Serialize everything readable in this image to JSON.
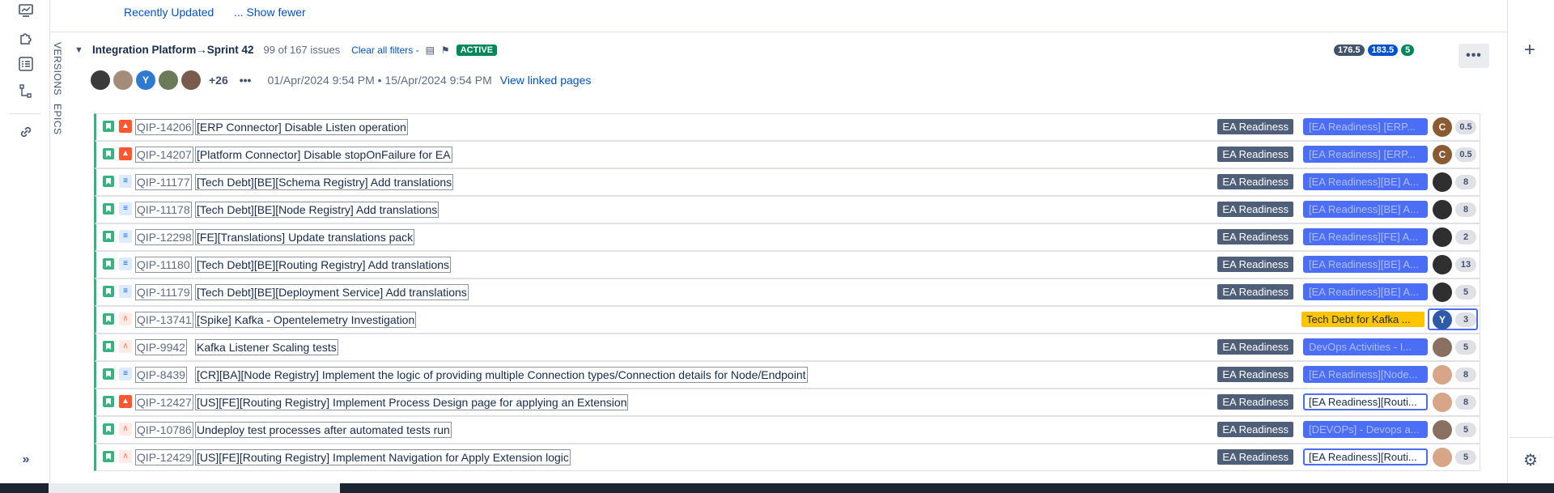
{
  "top_links": {
    "recent": "Recently Updated",
    "show_fewer": "... Show fewer"
  },
  "vertical_tabs": {
    "versions": "VERSIONS",
    "epics": "EPICS"
  },
  "sprint": {
    "name": "Integration Platform→Sprint 42",
    "issue_count": "99 of 167 issues",
    "clear_filters": "Clear all filters -",
    "status": "ACTIVE",
    "points": [
      "176.5",
      "183.5",
      "5"
    ],
    "extra_people": "+26",
    "dates": "01/Apr/2024 9:54 PM •  15/Apr/2024 9:54 PM",
    "view_linked": "View linked pages"
  },
  "avatars": [
    {
      "letter": "",
      "color": "#3b3b3b"
    },
    {
      "letter": "",
      "color": "#a58b7a"
    },
    {
      "letter": "Y",
      "color": "#2e7ad1"
    },
    {
      "letter": "",
      "color": "#6b7b5a"
    },
    {
      "letter": "",
      "color": "#7a5a4a"
    }
  ],
  "issues": [
    {
      "key": "QIP-14206",
      "summary": "[ERP Connector] Disable Listen operation",
      "epic": "EA Readiness",
      "version": "[EA Readiness] [ERP...",
      "prio": "high",
      "assignee": "C",
      "assignee_color": "#8a5a32",
      "est": "0.5",
      "version_style": "filled"
    },
    {
      "key": "QIP-14207",
      "summary": "[Platform Connector] Disable stopOnFailure for EA",
      "epic": "EA Readiness",
      "version": "[EA Readiness] [ERP...",
      "prio": "high",
      "assignee": "C",
      "assignee_color": "#8a5a32",
      "est": "0.5",
      "version_style": "filled"
    },
    {
      "key": "QIP-11177",
      "summary": "[Tech Debt][BE][Schema Registry] Add translations",
      "epic": "EA Readiness",
      "version": "[EA Readiness][BE] A...",
      "prio": "low",
      "assignee": "",
      "assignee_color": "#2f2f2f",
      "est": "8",
      "version_style": "filled"
    },
    {
      "key": "QIP-11178",
      "summary": "[Tech Debt][BE][Node Registry] Add translations",
      "epic": "EA Readiness",
      "version": "[EA Readiness][BE] A...",
      "prio": "low",
      "assignee": "",
      "assignee_color": "#2f2f2f",
      "est": "8",
      "version_style": "filled"
    },
    {
      "key": "QIP-12298",
      "summary": "[FE][Translations] Update translations pack",
      "epic": "EA Readiness",
      "version": "[EA Readiness][FE] A...",
      "prio": "low",
      "assignee": "",
      "assignee_color": "#2f2f2f",
      "est": "2",
      "version_style": "filled"
    },
    {
      "key": "QIP-11180",
      "summary": "[Tech Debt][BE][Routing Registry] Add translations",
      "epic": "EA Readiness",
      "version": "[EA Readiness][BE] A...",
      "prio": "low",
      "assignee": "",
      "assignee_color": "#2f2f2f",
      "est": "13",
      "version_style": "filled"
    },
    {
      "key": "QIP-11179",
      "summary": "[Tech Debt][BE][Deployment Service] Add translations",
      "epic": "EA Readiness",
      "version": "[EA Readiness][BE] A...",
      "prio": "low",
      "assignee": "",
      "assignee_color": "#2f2f2f",
      "est": "5",
      "version_style": "filled"
    },
    {
      "key": "QIP-13741",
      "summary": "[Spike] Kafka - Opentelemetry Investigation",
      "epic": "",
      "version": "Tech Debt for Kafka ...",
      "prio": "med",
      "assignee": "Y",
      "assignee_color": "#2e5aa8",
      "est": "3",
      "version_style": "yellow"
    },
    {
      "key": "QIP-9942",
      "summary": "Kafka Listener Scaling tests",
      "epic": "EA Readiness",
      "version": "DevOps Activities - I...",
      "prio": "med",
      "assignee": "",
      "assignee_color": "#8a7060",
      "est": "5",
      "version_style": "filled"
    },
    {
      "key": "QIP-8439",
      "summary": "[CR][BA][Node Registry] Implement the logic of providing multiple Connection types/Connection details for Node/Endpoint",
      "epic": "EA Readiness",
      "version": "[EA Readiness][Node...",
      "prio": "low",
      "assignee": "",
      "assignee_color": "#d9a588",
      "est": "8",
      "version_style": "filled"
    },
    {
      "key": "QIP-12427",
      "summary": "[US][FE][Routing Registry] Implement Process Design page for applying an Extension",
      "epic": "EA Readiness",
      "version": "[EA Readiness][Routi...",
      "prio": "high",
      "assignee": "",
      "assignee_color": "#d9a588",
      "est": "8",
      "version_style": "plain"
    },
    {
      "key": "QIP-10786",
      "summary": "Undeploy test processes after automated tests run",
      "epic": "EA Readiness",
      "version": "[DEVOPs] - Devops a...",
      "prio": "med",
      "assignee": "",
      "assignee_color": "#8a7060",
      "est": "5",
      "version_style": "filled"
    },
    {
      "key": "QIP-12429",
      "summary": "[US][FE][Routing Registry] Implement Navigation for Apply Extension logic",
      "epic": "EA Readiness",
      "version": "[EA Readiness][Routi...",
      "prio": "med",
      "assignee": "",
      "assignee_color": "#d9a588",
      "est": "5",
      "version_style": "plain"
    }
  ],
  "colors": {
    "points": [
      "#42526e",
      "#0052cc",
      "#00875a"
    ],
    "accent": "#0052cc",
    "active": "#00875a"
  }
}
